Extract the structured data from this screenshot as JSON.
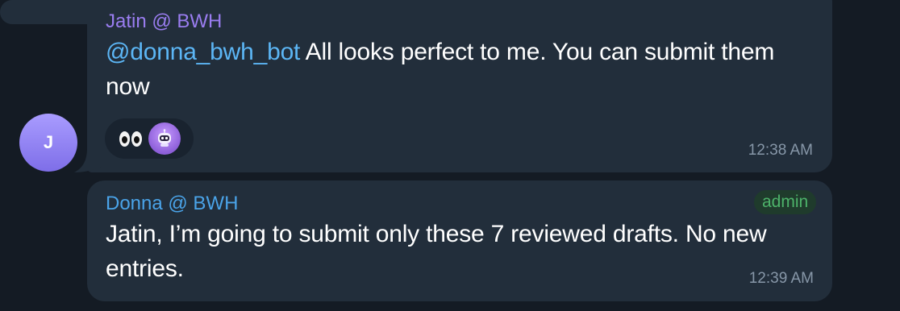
{
  "messages": [
    {
      "sender": "Jatin @ BWH",
      "avatar_initial": "J",
      "mention": "@donna_bwh_bot",
      "text": " All looks perfect to me. You can submit them now",
      "reactions": [
        "eyes-emoji",
        "bot-avatar"
      ],
      "time": "12:38 AM"
    },
    {
      "sender": "Donna @ BWH",
      "badge": "admin",
      "text": "Jatin, I’m going to submit only these 7 reviewed drafts. No new entries.",
      "time": "12:39 AM"
    }
  ],
  "colors": {
    "background": "#141b24",
    "bubble": "#222e3b",
    "jatin_name": "#9a7df0",
    "donna_name": "#4aa3e8",
    "mention": "#5cb6f5",
    "admin_badge_text": "#4db36a",
    "time": "#8797a8"
  }
}
